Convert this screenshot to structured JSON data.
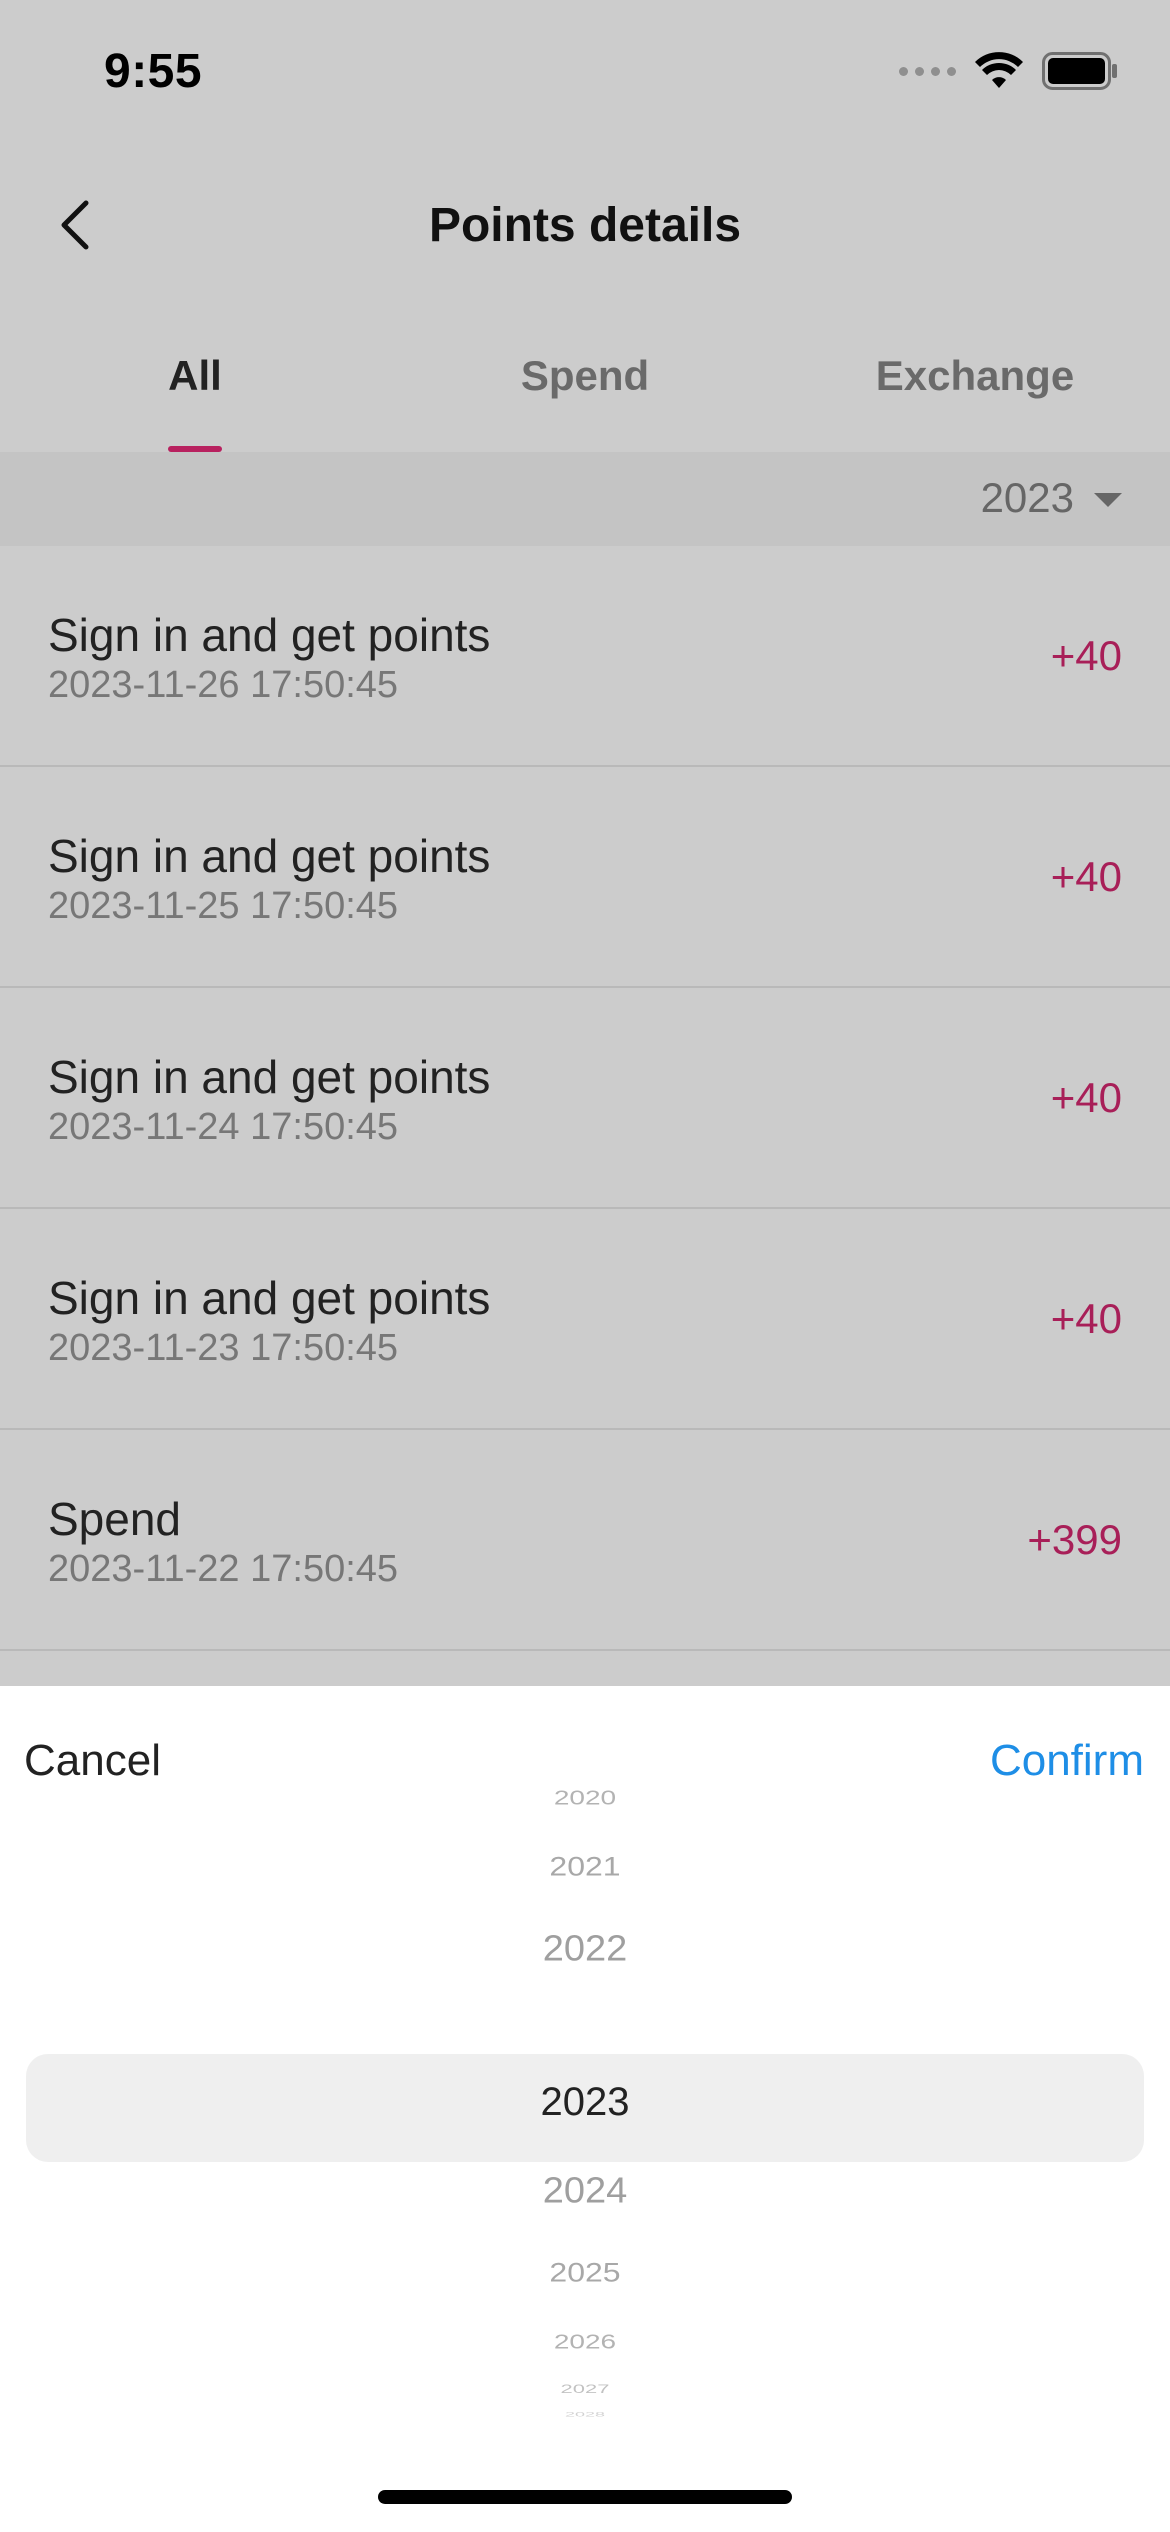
{
  "status_bar": {
    "time": "9:55"
  },
  "nav": {
    "title": "Points details"
  },
  "tabs": [
    {
      "label": "All",
      "active": true
    },
    {
      "label": "Spend",
      "active": false
    },
    {
      "label": "Exchange",
      "active": false
    }
  ],
  "filter": {
    "year": "2023"
  },
  "records": [
    {
      "title": "Sign in and get points",
      "date": "2023-11-26 17:50:45",
      "points": "+40"
    },
    {
      "title": "Sign in and get points",
      "date": "2023-11-25 17:50:45",
      "points": "+40"
    },
    {
      "title": "Sign in and get points",
      "date": "2023-11-24 17:50:45",
      "points": "+40"
    },
    {
      "title": "Sign in and get points",
      "date": "2023-11-23 17:50:45",
      "points": "+40"
    },
    {
      "title": "Spend",
      "date": "2023-11-22 17:50:45",
      "points": "+399"
    }
  ],
  "picker": {
    "cancel_label": "Cancel",
    "confirm_label": "Confirm",
    "years": [
      "2020",
      "2021",
      "2022",
      "2023",
      "2024",
      "2025",
      "2026",
      "2027",
      "2028"
    ],
    "selected": "2023"
  },
  "colors": {
    "accent": "#b8215f",
    "points_positive": "#a81f58",
    "confirm": "#1e8ee6"
  }
}
